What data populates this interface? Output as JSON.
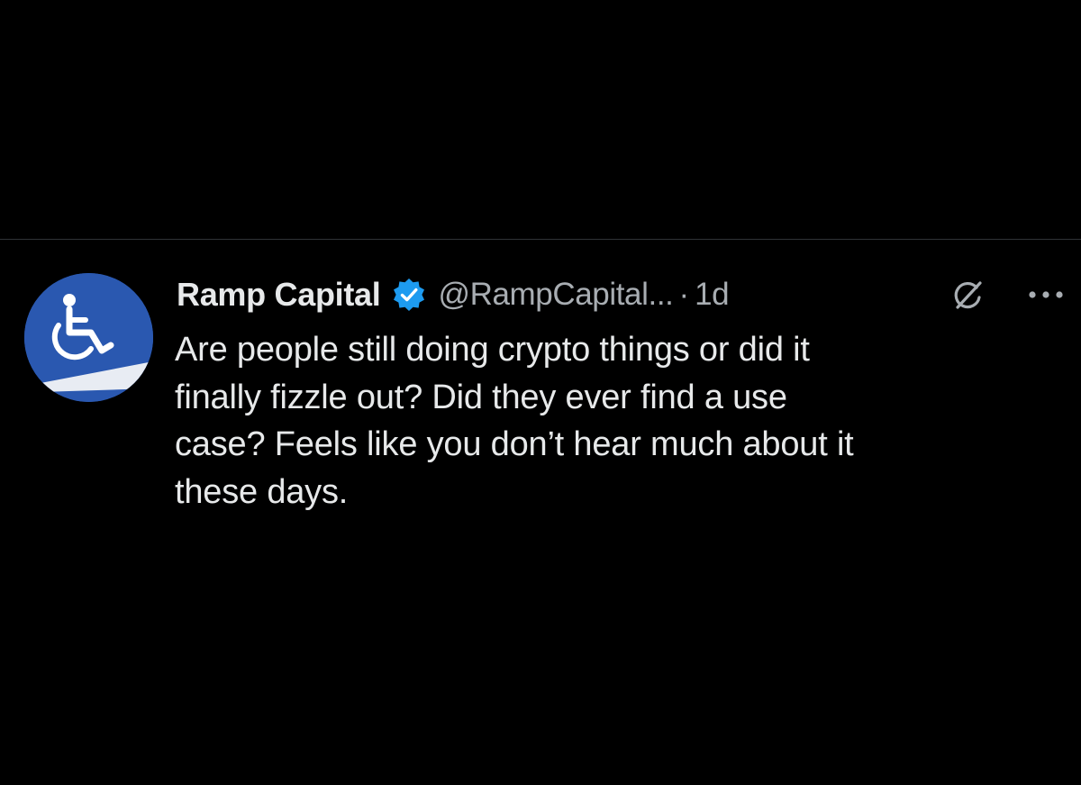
{
  "tweet": {
    "display_name": "Ramp Capital",
    "verified_icon": "verified-badge-icon",
    "handle": "@RampCapital...",
    "separator": "·",
    "time": "1d",
    "text": "Are people still doing crypto things or did it\nfinally fizzle out? Did they ever find a use\ncase? Feels like you don’t hear much about it\nthese days.",
    "avatar_icon": "wheelchair-icon",
    "grok_icon": "grok-icon",
    "more_icon": "more-options-icon"
  },
  "colors": {
    "background": "#000000",
    "text_primary": "#e7e9ea",
    "text_secondary": "#a8adb2",
    "verified_blue": "#1d9bf0",
    "avatar_blue": "#2a58b0",
    "divider": "#2f3336"
  }
}
